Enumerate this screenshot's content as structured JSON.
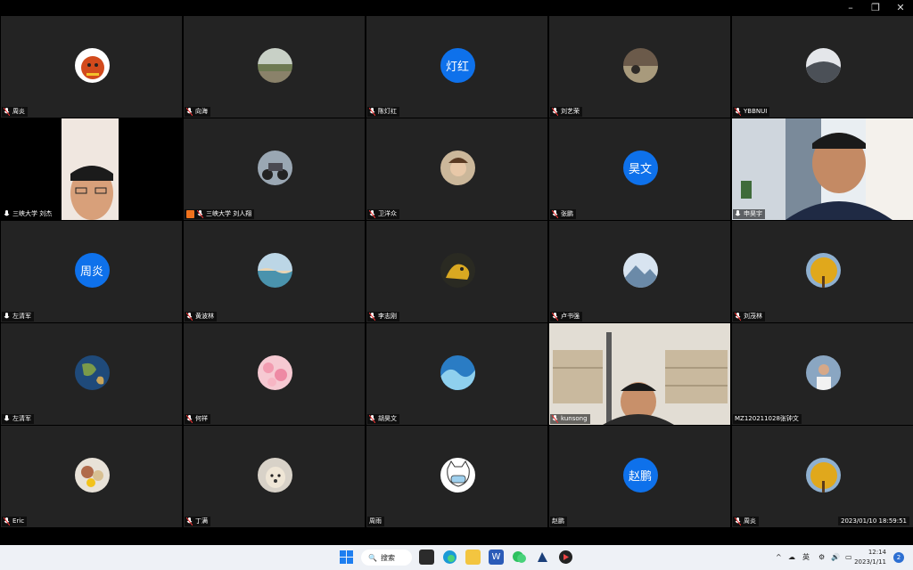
{
  "window": {
    "minimize_glyph": "–",
    "maximize_glyph": "❐",
    "close_glyph": "✕"
  },
  "participants": [
    {
      "name": "周炎",
      "avatar": "red-dog-avatar",
      "muted": true
    },
    {
      "name": "向海",
      "avatar": "landscape-avatar",
      "muted": true
    },
    {
      "name": "陈灯红",
      "initials": "灯红",
      "muted": true
    },
    {
      "name": "刘艺荣",
      "avatar": "photo-avatar",
      "muted": true
    },
    {
      "name": "YBBNUI",
      "avatar": "landscape-avatar",
      "muted": true
    },
    {
      "name": "三峡大学 刘杰",
      "video": "webcam-man",
      "muted": false
    },
    {
      "name": "三峡大学 刘人翔",
      "avatar": "motorcycle-avatar",
      "muted": true,
      "host": true
    },
    {
      "name": "卫洋众",
      "avatar": "cartoon-avatar",
      "muted": true
    },
    {
      "name": "张鹏",
      "initials": "昊文",
      "muted": true
    },
    {
      "name": "申昊宇",
      "video": "webcam-smile",
      "muted": false
    },
    {
      "name": "左清军",
      "initials": "周炎",
      "muted": false
    },
    {
      "name": "黄波林",
      "avatar": "sea-avatar",
      "muted": true
    },
    {
      "name": "李志刚",
      "avatar": "gold-dragon-avatar",
      "muted": true
    },
    {
      "name": "卢书强",
      "avatar": "mountain-avatar",
      "muted": true
    },
    {
      "name": "刘茂林",
      "avatar": "ginkgo-avatar",
      "muted": true
    },
    {
      "name": "左清军",
      "avatar": "earth-avatar",
      "muted": false
    },
    {
      "name": "何祥",
      "avatar": "blossom-avatar",
      "muted": true
    },
    {
      "name": "胡昊文",
      "avatar": "wave-avatar",
      "muted": true
    },
    {
      "name": "kunsong",
      "video": "webcam-bookshelf",
      "muted": true
    },
    {
      "name": "MZ120211028张钟文",
      "avatar": "person-avatar",
      "muted": false,
      "nomic": true
    },
    {
      "name": "Eric",
      "avatar": "food-avatar",
      "muted": true
    },
    {
      "name": "丁满",
      "avatar": "dog-avatar",
      "muted": true
    },
    {
      "name": "周雨",
      "avatar": "cat-mask-avatar",
      "muted": false,
      "nomic": true
    },
    {
      "name": "赵鹏",
      "initials": "赵鹏",
      "muted": false,
      "nomic": true
    },
    {
      "name": "周炎",
      "avatar": "ginkgo-avatar",
      "muted": true
    }
  ],
  "timestamp": "2023/01/10 18:59:51",
  "taskbar": {
    "search_label": "搜索",
    "tray_ime": "英",
    "time": "12:14",
    "date": "2023/1/11",
    "notification_count": "2"
  },
  "colors": {
    "accent": "#0e71eb",
    "tile_bg": "#232323"
  }
}
